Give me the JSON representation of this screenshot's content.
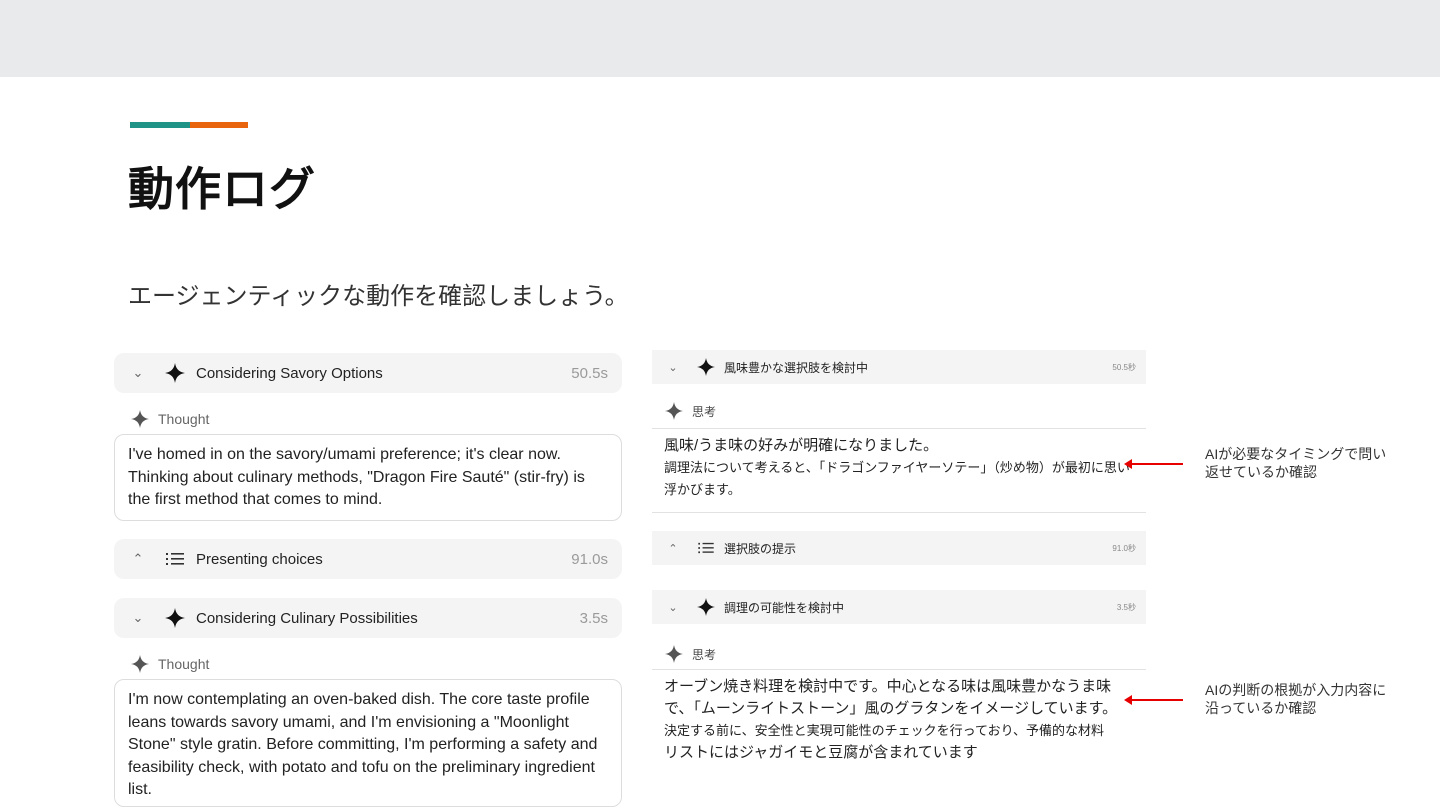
{
  "header": {
    "title": "動作ログ",
    "subtitle": "エージェンティックな動作を確認しましょう。",
    "accent_colors": [
      "#1f9486",
      "#e8650d"
    ]
  },
  "left_log": {
    "items": [
      {
        "title": "Considering Savory Options",
        "time": "50.5s",
        "icon": "sparkle-icon",
        "chevron": "chevron-down-icon"
      },
      {
        "title": "Presenting choices",
        "time": "91.0s",
        "icon": "list-icon",
        "chevron": "chevron-up-icon"
      },
      {
        "title": "Considering Culinary Possibilities",
        "time": "3.5s",
        "icon": "sparkle-icon",
        "chevron": "chevron-down-icon"
      }
    ],
    "thought_label": "Thought",
    "thought_1": "I've homed in on the savory/umami preference; it's clear now. Thinking about culinary methods, \"Dragon Fire Sauté\" (stir-fry) is the first method that comes to mind.",
    "thought_2": "I'm now contemplating an oven-baked dish. The core taste profile leans towards savory umami, and I'm envisioning a \"Moonlight Stone\" style gratin. Before committing, I'm performing a safety and feasibility check, with potato and tofu on the preliminary ingredient list."
  },
  "right_log": {
    "items": [
      {
        "title": "風味豊かな選択肢を検討中",
        "time": "50.5秒"
      },
      {
        "title": "選択肢の提示",
        "time": "91.0秒"
      },
      {
        "title": "調理の可能性を検討中",
        "time": "3.5秒"
      }
    ],
    "thought_label": "思考",
    "thought_1_line1": "風味/うま味の好みが明確になりました。",
    "thought_1_line2": "調理法について考えると、「ドラゴンファイヤーソテー」（炒め物）が最初に思い浮かびます。",
    "thought_2_line1": "オーブン焼き料理を検討中です。中心となる味は風味豊かなうま味で、「ムーンライトストーン」風のグラタンをイメージしています。",
    "thought_2_line2": "決定する前に、安全性と実現可能性のチェックを行っており、予備的な材料",
    "thought_2_line3": "リストにはジャガイモと豆腐が含まれています"
  },
  "annotations": {
    "note_1": "AIが必要なタイミングで問い返せているか確認",
    "note_2": "AIの判断の根拠が入力内容に沿っているか確認",
    "arrow_color": "#e60000"
  }
}
